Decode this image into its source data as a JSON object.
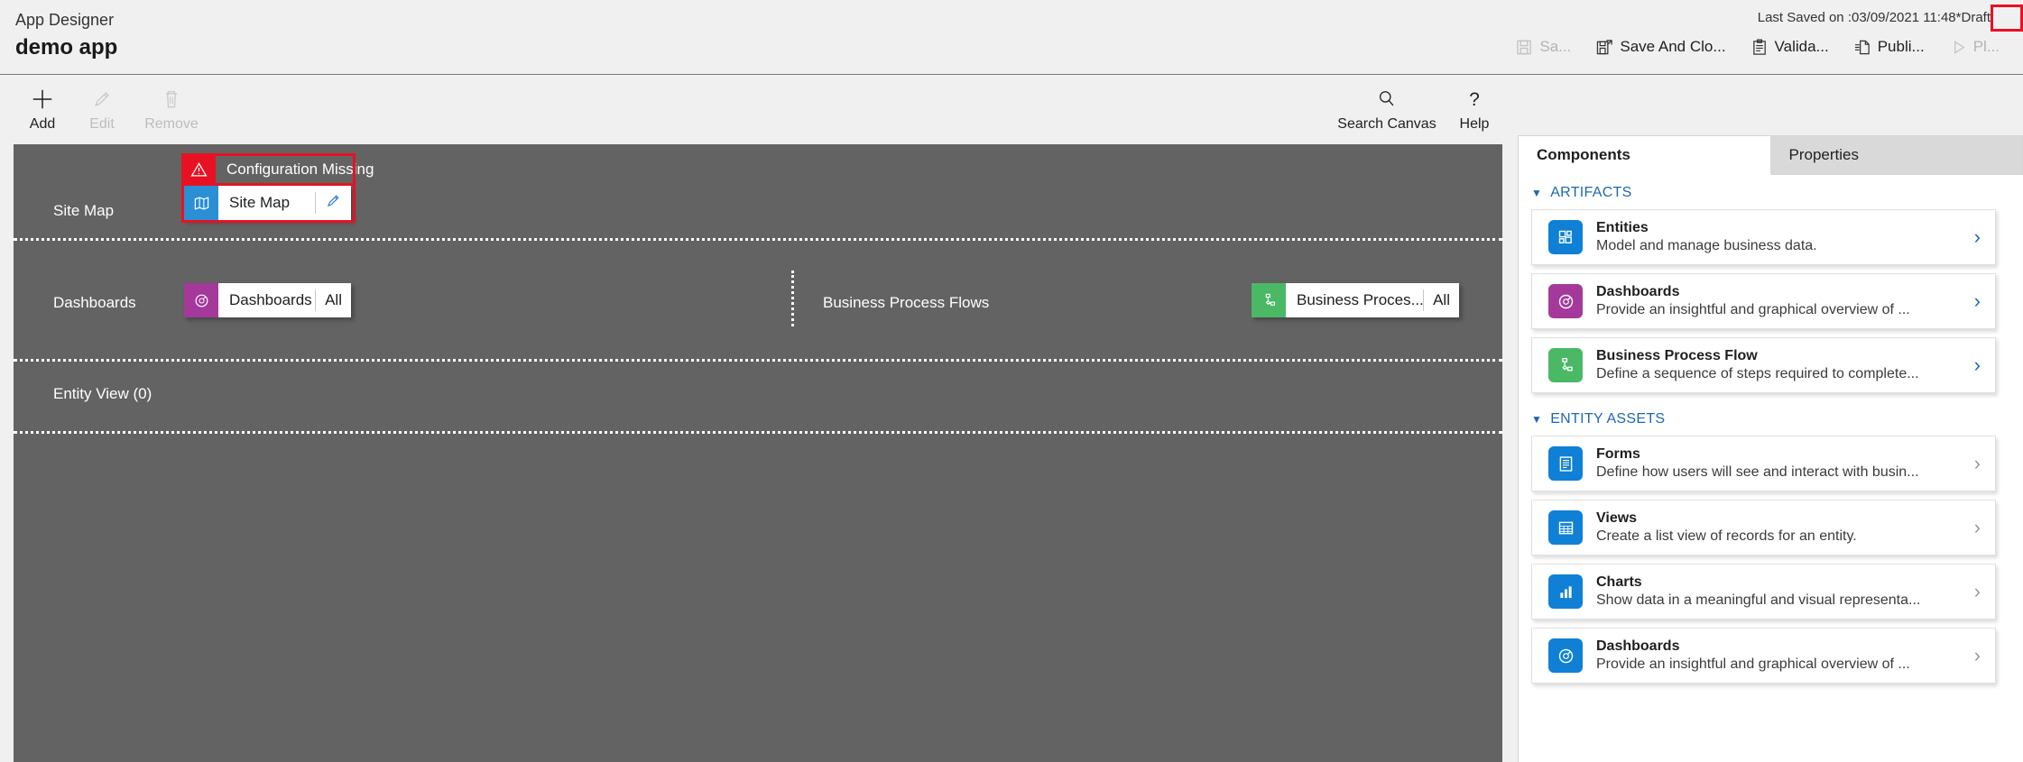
{
  "header": {
    "subtitle": "App Designer",
    "title": "demo app",
    "saved_info": "Last Saved on :03/09/2021 11:48",
    "draft_badge": "*Draft",
    "draft_highlight_color": "#e81123",
    "commands": [
      {
        "label": "Sa...",
        "icon": "save-icon",
        "disabled": true
      },
      {
        "label": "Save And Clo...",
        "icon": "save-and-close-icon",
        "disabled": false
      },
      {
        "label": "Valida...",
        "icon": "validate-icon",
        "disabled": false
      },
      {
        "label": "Publi...",
        "icon": "publish-icon",
        "disabled": false
      },
      {
        "label": "Pl...",
        "icon": "play-icon",
        "disabled": true
      }
    ]
  },
  "ribbon": {
    "add": {
      "label": "Add",
      "icon": "plus-icon",
      "disabled": false
    },
    "edit": {
      "label": "Edit",
      "icon": "pencil-icon",
      "disabled": true
    },
    "remove": {
      "label": "Remove",
      "icon": "trash-icon",
      "disabled": true
    },
    "search": {
      "label": "Search Canvas",
      "icon": "search-icon",
      "disabled": false
    },
    "help": {
      "label": "Help",
      "icon": "question-icon",
      "disabled": false
    }
  },
  "canvas": {
    "background": "#636363",
    "sitemap_row": {
      "label": "Site Map",
      "warning": "Configuration Missing",
      "warning_color": "#e81123",
      "tile": {
        "name": "Site Map",
        "icon": "map-icon",
        "icon_color": "#2a8fd4",
        "action_icon": "pencil-icon",
        "highlighted": true
      }
    },
    "dashboards_row": {
      "label": "Dashboards",
      "tile": {
        "name": "Dashboards",
        "badge": "All",
        "icon": "dashboard-gauge-icon",
        "icon_color": "#a4399b"
      }
    },
    "bpf_row": {
      "label": "Business Process Flows",
      "tile": {
        "name": "Business Proces...",
        "badge": "All",
        "icon": "bpf-icon",
        "icon_color": "#4bb866"
      }
    },
    "entity_row": {
      "label": "Entity View (0)"
    }
  },
  "right_panel": {
    "tabs": [
      {
        "label": "Components",
        "active": true
      },
      {
        "label": "Properties",
        "active": false
      }
    ],
    "groups": [
      {
        "title": "ARTIFACTS",
        "expanded": true,
        "cards": [
          {
            "title": "Entities",
            "desc": "Model and manage business data.",
            "icon": "entities-icon",
            "icon_color": "#0f80d6",
            "chevron": "bright"
          },
          {
            "title": "Dashboards",
            "desc": "Provide an insightful and graphical overview of ...",
            "icon": "dashboard-gauge-icon",
            "icon_color": "#a4399b",
            "chevron": "bright"
          },
          {
            "title": "Business Process Flow",
            "desc": "Define a sequence of steps required to complete...",
            "icon": "bpf-icon",
            "icon_color": "#4bb866",
            "chevron": "bright"
          }
        ]
      },
      {
        "title": "ENTITY ASSETS",
        "expanded": true,
        "cards": [
          {
            "title": "Forms",
            "desc": "Define how users will see and interact with busin...",
            "icon": "forms-icon",
            "icon_color": "#0f80d6",
            "chevron": "dim"
          },
          {
            "title": "Views",
            "desc": "Create a list view of records for an entity.",
            "icon": "views-grid-icon",
            "icon_color": "#0f80d6",
            "chevron": "dim"
          },
          {
            "title": "Charts",
            "desc": "Show data in a meaningful and visual representa...",
            "icon": "charts-bar-icon",
            "icon_color": "#0f80d6",
            "chevron": "dim"
          },
          {
            "title": "Dashboards",
            "desc": "Provide an insightful and graphical overview of ...",
            "icon": "dashboard-gauge-icon",
            "icon_color": "#0f80d6",
            "chevron": "dim"
          }
        ]
      }
    ]
  }
}
